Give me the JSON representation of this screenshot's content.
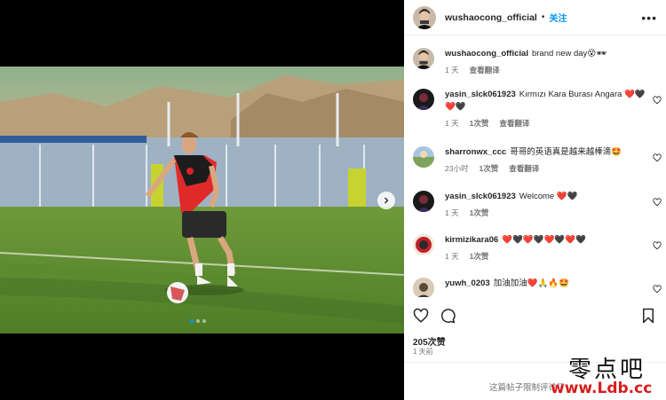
{
  "post": {
    "username": "wushaocong_official",
    "follow_label": "关注",
    "separator": "•",
    "more_label": "•••"
  },
  "comments": [
    {
      "user": "wushaocong_official",
      "text": "brand new day😵🕶",
      "time": "1 天",
      "likes": "",
      "translate": "查看翻译"
    },
    {
      "user": "yasin_slck061923",
      "text": "Kırmızı Kara Burası Angara ❤️🖤❤️🖤",
      "time": "1 天",
      "likes": "1次赞",
      "translate": "查看翻译"
    },
    {
      "user": "sharronwx_ccc",
      "text": "哥哥的英语真是越来越棒滴🤩",
      "time": "23小时",
      "likes": "1次赞",
      "translate": "查看翻译"
    },
    {
      "user": "yasin_slck061923",
      "text": "Welcome ❤️🖤",
      "time": "1 天",
      "likes": "1次赞",
      "translate": ""
    },
    {
      "user": "kirmizikara06",
      "text": "❤️🖤❤️🖤❤️🖤❤️🖤",
      "time": "1 天",
      "likes": "1次赞",
      "translate": ""
    },
    {
      "user": "yuwh_0203",
      "text": "加油加油❤️🙏🔥🤩",
      "time": "",
      "likes": "",
      "translate": ""
    }
  ],
  "actions": {
    "like_icon": "heart-icon",
    "comment_icon": "comment-icon",
    "save_icon": "bookmark-icon"
  },
  "likes_count": "205次赞",
  "posted_ago": "1 天前",
  "comments_limited": "这篇帖子限制评论了",
  "watermark": {
    "text": "零点吧",
    "url": "www.Ldb.cc"
  },
  "colors": {
    "follow": "#0095f6",
    "heart_red": "#ed4956",
    "watermark_red": "#d71d1d"
  }
}
